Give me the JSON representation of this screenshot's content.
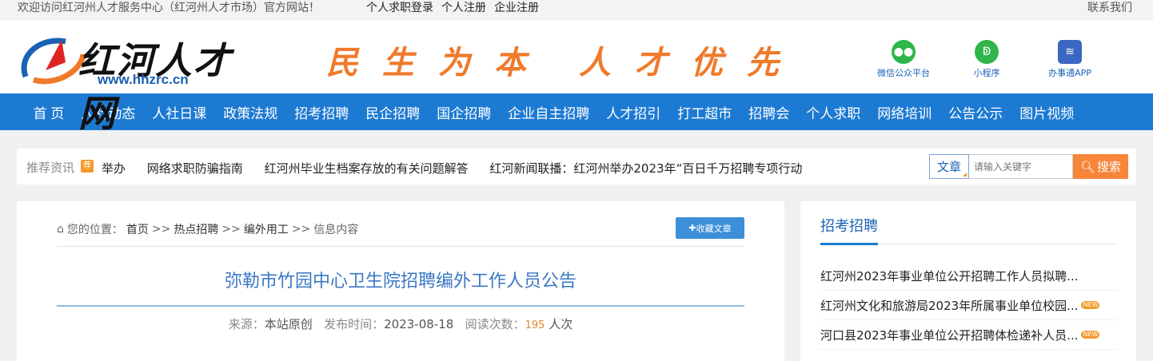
{
  "topbar": {
    "welcome": "欢迎访问红河州人才服务中心（红河州人才市场）官方网站！",
    "links": [
      "个人求职登录",
      "个人注册",
      "企业注册"
    ],
    "contact": "联系我们"
  },
  "header": {
    "logo_text": "红河人才网",
    "logo_url": "www.hhzrc.cn",
    "slogan": [
      "民",
      "生",
      "为",
      "本",
      "人",
      "才",
      "优",
      "先"
    ],
    "apps": [
      {
        "label": "微信公众平台",
        "icon": "wechat-icon",
        "color": "#2fb54a"
      },
      {
        "label": "小程序",
        "icon": "mini-program-icon",
        "color": "#2fb54a"
      },
      {
        "label": "办事通APP",
        "icon": "app-icon",
        "color": "#3a67c2"
      }
    ]
  },
  "nav": [
    "首 页",
    "人社动态",
    "人社日课",
    "政策法规",
    "招考招聘",
    "民企招聘",
    "国企招聘",
    "企业自主招聘",
    "人才招引",
    "打工超市",
    "招聘会",
    "个人求职",
    "网络培训",
    "公告公示",
    "图片视频"
  ],
  "news": {
    "label": "推荐资讯",
    "tag": "荐",
    "items": [
      "举办",
      "网络求职防骗指南",
      "红河州毕业生档案存放的有关问题解答",
      "红河新闻联播：红河州举办2023年“百日千万招聘专项行动"
    ]
  },
  "search": {
    "type": "文章",
    "placeholder": "请输入关键字",
    "button": "搜索"
  },
  "article": {
    "crumb_label": "您的位置：",
    "crumbs": [
      "首页",
      ">>",
      "热点招聘",
      ">>",
      "编外用工",
      ">>",
      "信息内容"
    ],
    "fav_button": "收藏文章",
    "title": "弥勒市竹园中心卫生院招聘编外工作人员公告",
    "source_label": "来源：",
    "source": "本站原创",
    "time_label": "发布时间：",
    "time": "2023-08-18",
    "views_label": "阅读次数：",
    "views": "195",
    "views_unit": "人次"
  },
  "sidebar": {
    "heading": "招考招聘",
    "items": [
      {
        "text": "红河州2023年事业单位公开招聘工作人员拟聘...",
        "new": false
      },
      {
        "text": "红河州文化和旅游局2023年所属事业单位校园...",
        "new": true
      },
      {
        "text": "河口县2023年事业单位公开招聘体检递补人员...",
        "new": true
      }
    ],
    "new_badge": "NEW"
  }
}
